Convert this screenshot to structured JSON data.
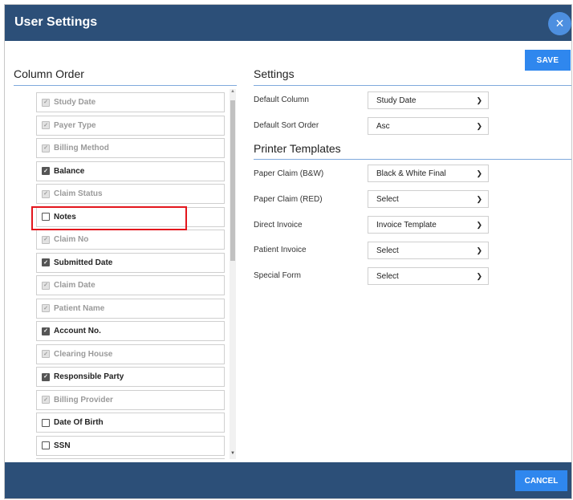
{
  "dialog": {
    "title": "User Settings",
    "close_label": "×"
  },
  "save_label": "SAVE",
  "cancel_label": "CANCEL",
  "column_order": {
    "title": "Column Order",
    "items": [
      {
        "label": "Study Date",
        "checked": true,
        "disabled": true
      },
      {
        "label": "Payer Type",
        "checked": true,
        "disabled": true
      },
      {
        "label": "Billing Method",
        "checked": true,
        "disabled": true
      },
      {
        "label": "Balance",
        "checked": true,
        "disabled": false
      },
      {
        "label": "Claim Status",
        "checked": true,
        "disabled": true
      },
      {
        "label": "Notes",
        "checked": false,
        "disabled": false
      },
      {
        "label": "Claim No",
        "checked": true,
        "disabled": true
      },
      {
        "label": "Submitted Date",
        "checked": true,
        "disabled": false
      },
      {
        "label": "Claim Date",
        "checked": true,
        "disabled": true
      },
      {
        "label": "Patient Name",
        "checked": true,
        "disabled": true
      },
      {
        "label": "Account No.",
        "checked": true,
        "disabled": false
      },
      {
        "label": "Clearing House",
        "checked": true,
        "disabled": true
      },
      {
        "label": "Responsible Party",
        "checked": true,
        "disabled": false
      },
      {
        "label": "Billing Provider",
        "checked": true,
        "disabled": true
      },
      {
        "label": "Date Of Birth",
        "checked": false,
        "disabled": false
      },
      {
        "label": "SSN",
        "checked": false,
        "disabled": false
      },
      {
        "label": "",
        "checked": false,
        "disabled": false
      }
    ]
  },
  "settings": {
    "title": "Settings",
    "default_column": {
      "label": "Default Column",
      "value": "Study Date"
    },
    "default_sort": {
      "label": "Default Sort Order",
      "value": "Asc"
    }
  },
  "printer_templates": {
    "title": "Printer Templates",
    "paper_claim_bw": {
      "label": "Paper Claim (B&W)",
      "value": "Black & White Final"
    },
    "paper_claim_red": {
      "label": "Paper Claim (RED)",
      "value": "Select"
    },
    "direct_invoice": {
      "label": "Direct Invoice",
      "value": "Invoice Template"
    },
    "patient_invoice": {
      "label": "Patient Invoice",
      "value": "Select"
    },
    "special_form": {
      "label": "Special Form",
      "value": "Select"
    }
  },
  "colors": {
    "header": "#2c4f78",
    "accent": "#2f87ee",
    "highlight": "#e3161d"
  }
}
